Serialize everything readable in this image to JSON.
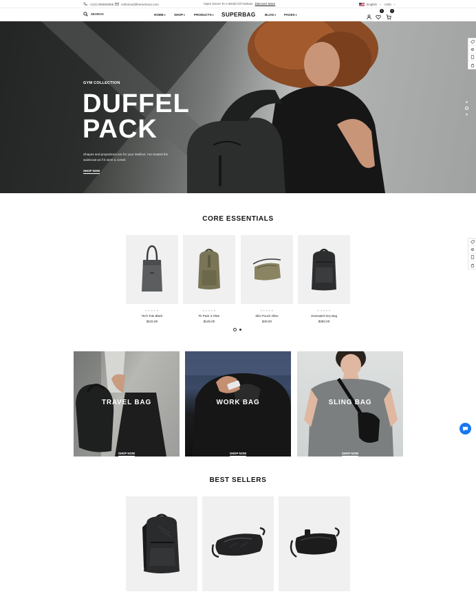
{
  "topbar": {
    "phone": "+(12) 006550808",
    "email": "mrlinimo@themerious.com",
    "promo": "Open Doors To A World Of Fashion",
    "discover": "Discover More",
    "language": "English",
    "currency": "USD"
  },
  "nav": {
    "search_label": "SEARCH",
    "menu": [
      "HOME",
      "SHOP",
      "PRODUCTS"
    ],
    "logo": "SUPERBAG",
    "menu_right": [
      "BLOG",
      "PAGES"
    ],
    "wishlist_count": "0",
    "cart_count": "0"
  },
  "hero": {
    "tag": "GYM COLLECTION",
    "title": "DUFFEL PACK",
    "description": "Shapes and proportions are for your intellect. I've treated the waistcoat as if it were a corset.",
    "cta": "SHOP NOW",
    "slide_count": 3,
    "active_slide": 1
  },
  "core": {
    "title": "CORE ESSENTIALS",
    "products": [
      {
        "name": "Tech Tote Black",
        "price": "$115.00",
        "icon": "tote-bag-icon"
      },
      {
        "name": "Fit Pack 3 Olive",
        "price": "$145.00",
        "icon": "backpack-olive-icon"
      },
      {
        "name": "Slim Pouch Olive",
        "price": "$49.00",
        "icon": "pouch-icon"
      },
      {
        "name": "Overwatch Dry Bag",
        "price": "$350.00",
        "icon": "backpack-black-icon"
      }
    ],
    "rating_stars": "★★★★★"
  },
  "categories": [
    {
      "label": "TRAVEL BAG",
      "cta": "SHOP NOW"
    },
    {
      "label": "WORK BAG",
      "cta": "SHOP NOW"
    },
    {
      "label": "SLING BAG",
      "cta": "SHOP NOW"
    }
  ],
  "best": {
    "title": "BEST SELLERS",
    "items": [
      "backpack-icon",
      "sling-bag-icon",
      "hip-pack-icon"
    ]
  },
  "colors": {
    "accent": "#111111",
    "chat": "#1877f2"
  }
}
